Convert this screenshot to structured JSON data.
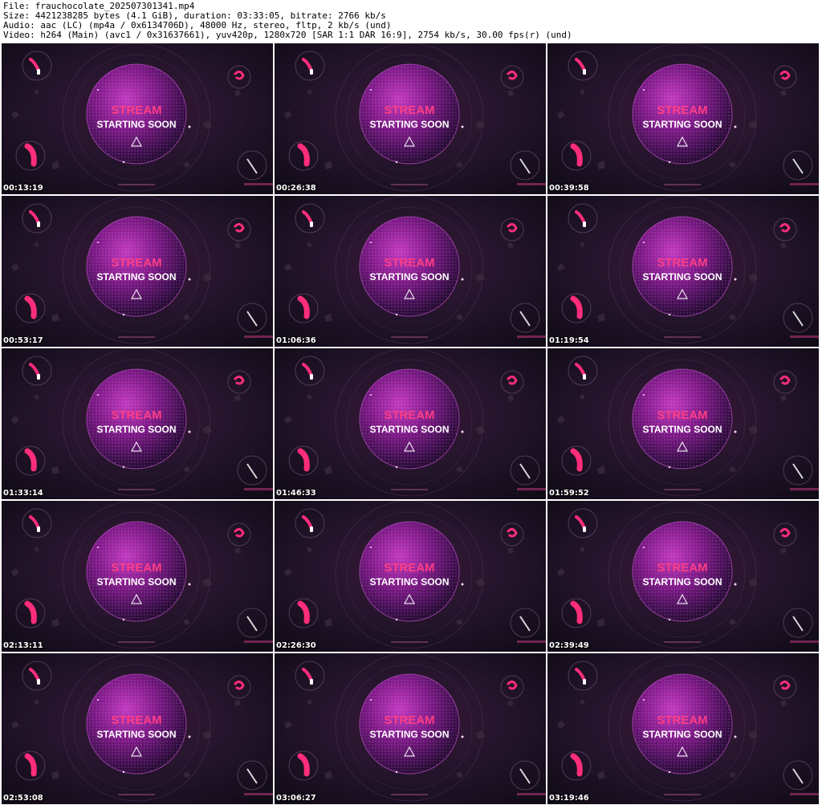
{
  "header": {
    "file_line": "File: frauchocolate_202507301341.mp4",
    "size_line": "Size: 4421238285 bytes (4.1 GiB), duration: 03:33:05, bitrate: 2766 kb/s",
    "audio_line": "Audio: aac (LC) (mp4a / 0x6134706D), 48000 Hz, stereo, fltp, 2 kb/s (und)",
    "video_line": "Video: h264 (Main) (avc1 / 0x31637661), yuv420p, 1280x720 [SAR 1:1 DAR 16:9], 2754 kb/s, 30.00 fps(r) (und)"
  },
  "thumbnail_text": {
    "line1": "STREAM",
    "line2": "STARTING SOON"
  },
  "colors": {
    "background": "#150d1d",
    "accent_pink": "#ff2d7a",
    "sphere_purple": "#8a1a8f"
  },
  "thumbnails": [
    {
      "timestamp": "00:13:19"
    },
    {
      "timestamp": "00:26:38"
    },
    {
      "timestamp": "00:39:58"
    },
    {
      "timestamp": "00:53:17"
    },
    {
      "timestamp": "01:06:36"
    },
    {
      "timestamp": "01:19:54"
    },
    {
      "timestamp": "01:33:14"
    },
    {
      "timestamp": "01:46:33"
    },
    {
      "timestamp": "01:59:52"
    },
    {
      "timestamp": "02:13:11"
    },
    {
      "timestamp": "02:26:30"
    },
    {
      "timestamp": "02:39:49"
    },
    {
      "timestamp": "02:53:08"
    },
    {
      "timestamp": "03:06:27"
    },
    {
      "timestamp": "03:19:46"
    }
  ]
}
